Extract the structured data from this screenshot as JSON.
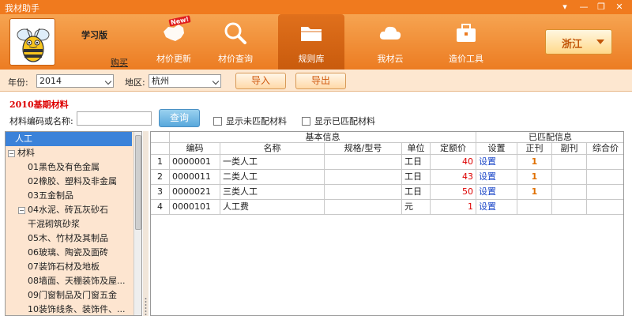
{
  "app": {
    "title": "我材助手",
    "edition": "学习版",
    "buy_link": "购买"
  },
  "window_controls": {
    "menu": "▾",
    "minimize": "—",
    "restore": "❐",
    "close": "✕"
  },
  "nav": [
    {
      "label": "材价更新",
      "icon": "china-map-icon",
      "badge": "New!"
    },
    {
      "label": "材价查询",
      "icon": "search-icon"
    },
    {
      "label": "规则库",
      "icon": "folder-icon"
    },
    {
      "label": "我材云",
      "icon": "cloud-icon"
    },
    {
      "label": "造价工具",
      "icon": "toolbox-icon"
    }
  ],
  "region": {
    "value": "浙江"
  },
  "toolbar": {
    "year_label": "年份:",
    "year_value": "2014",
    "area_label": "地区:",
    "area_value": "杭州",
    "import_label": "导入",
    "export_label": "导出"
  },
  "section": {
    "title": "2010基期材料",
    "search_label": "材料编码或名称:",
    "search_value": "",
    "query_label": "查询",
    "chk_unmatched": "显示未匹配材料",
    "chk_matched": "显示已匹配材料"
  },
  "tree": [
    {
      "label": "人工",
      "selected": true,
      "indent": 0,
      "expander": ""
    },
    {
      "label": "材料",
      "indent": 0,
      "expander": "−"
    },
    {
      "label": "01黑色及有色金属",
      "indent": 1,
      "expander": ""
    },
    {
      "label": "02橡胶、塑料及非金属",
      "indent": 1,
      "expander": ""
    },
    {
      "label": "03五金制品",
      "indent": 1,
      "expander": ""
    },
    {
      "label": "04水泥、砖瓦灰砂石",
      "indent": 1,
      "expander": "−"
    },
    {
      "label": "干混砌筑砂浆",
      "indent": 2,
      "expander": ""
    },
    {
      "label": "05木、竹材及其制品",
      "indent": 1,
      "expander": ""
    },
    {
      "label": "06玻璃、陶瓷及面砖",
      "indent": 1,
      "expander": ""
    },
    {
      "label": "07装饰石材及地板",
      "indent": 1,
      "expander": ""
    },
    {
      "label": "08墙面、天棚装饰及屋...",
      "indent": 1,
      "expander": ""
    },
    {
      "label": "09门窗制品及门窗五金",
      "indent": 1,
      "expander": ""
    },
    {
      "label": "10装饰线条、装饰件、...",
      "indent": 1,
      "expander": ""
    }
  ],
  "grid": {
    "group_basic": "基本信息",
    "group_matched": "已匹配信息",
    "columns": [
      "编码",
      "名称",
      "规格/型号",
      "单位",
      "定额价",
      "设置",
      "正刊",
      "副刊",
      "综合价"
    ],
    "rows": [
      {
        "no": "1",
        "code": "0000001",
        "name": "一类人工",
        "spec": "",
        "unit": "工日",
        "price": "40",
        "setting": "设置",
        "main": "1",
        "sub": "",
        "total": ""
      },
      {
        "no": "2",
        "code": "0000011",
        "name": "二类人工",
        "spec": "",
        "unit": "工日",
        "price": "43",
        "setting": "设置",
        "main": "1",
        "sub": "",
        "total": ""
      },
      {
        "no": "3",
        "code": "0000021",
        "name": "三类人工",
        "spec": "",
        "unit": "工日",
        "price": "50",
        "setting": "设置",
        "main": "1",
        "sub": "",
        "total": ""
      },
      {
        "no": "4",
        "code": "0000101",
        "name": "人工费",
        "spec": "",
        "unit": "元",
        "price": "1",
        "setting": "设置",
        "main": "",
        "sub": "",
        "total": ""
      }
    ]
  }
}
